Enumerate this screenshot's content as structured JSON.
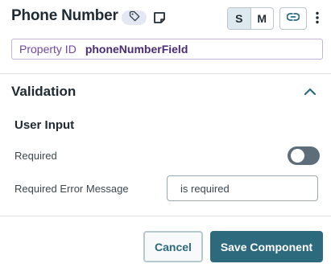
{
  "header": {
    "title": "Phone Number",
    "size_options": [
      "S",
      "M"
    ],
    "selected_size": "S"
  },
  "property": {
    "label": "Property ID",
    "value": "phoneNumberField"
  },
  "validation": {
    "section_title": "Validation",
    "expanded": true,
    "user_input_title": "User Input",
    "required_label": "Required",
    "required_enabled": false,
    "error_message_label": "Required Error Message",
    "error_message_value": "is required"
  },
  "footer": {
    "cancel_label": "Cancel",
    "save_label": "Save Component"
  },
  "colors": {
    "accent": "#2e6a7e",
    "property_border": "#c5b3d9",
    "property_text": "#4a2b76"
  }
}
